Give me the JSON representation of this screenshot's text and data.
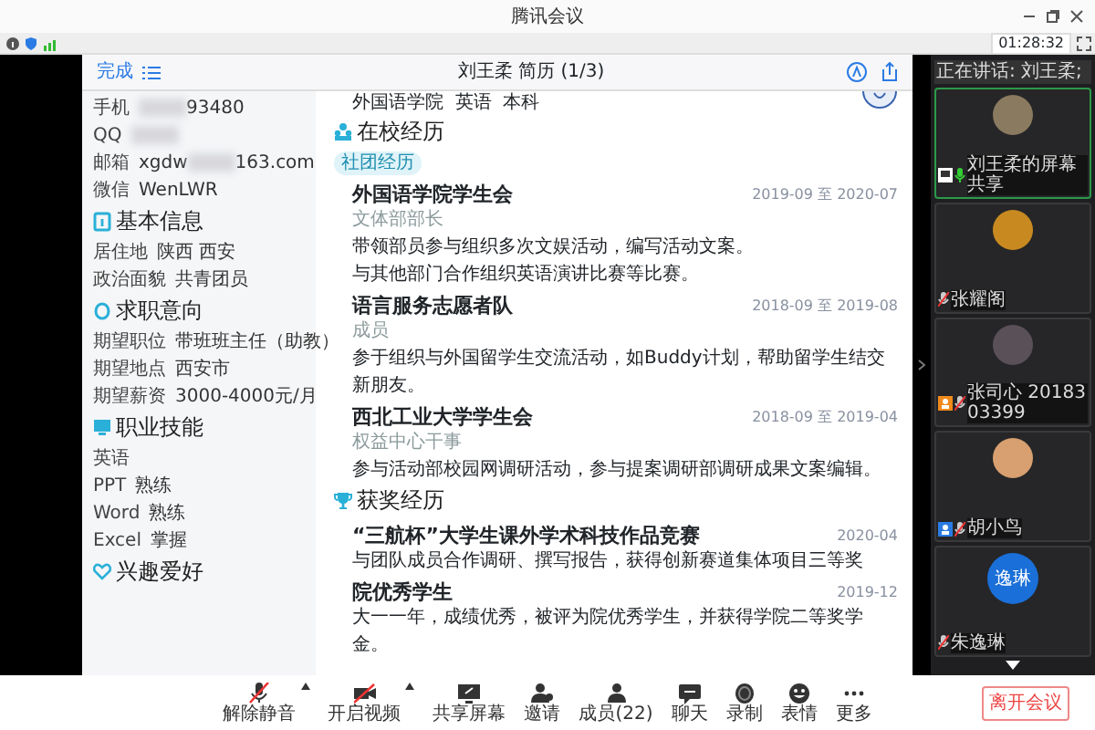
{
  "window": {
    "title": "腾讯会议"
  },
  "status_bar": {
    "timer": "01:28:32"
  },
  "document": {
    "done": "完成",
    "title": "刘王柔 简历 (1/3)",
    "education_line": "外国语学院  英语  本科",
    "contacts": [
      {
        "label": "手机",
        "parts": [
          {
            "kind": "blur"
          },
          {
            "kind": "text",
            "text": "93480"
          }
        ]
      },
      {
        "label": "QQ",
        "parts": [
          {
            "kind": "blur"
          }
        ]
      },
      {
        "label": "邮箱",
        "parts": [
          {
            "kind": "text",
            "text": "xgdw"
          },
          {
            "kind": "blur"
          },
          {
            "kind": "text",
            "text": "163.com"
          }
        ]
      },
      {
        "label": "微信",
        "parts": [
          {
            "kind": "text",
            "text": "WenLWR"
          }
        ]
      }
    ],
    "left_sections": [
      {
        "title": "基本信息",
        "items": [
          {
            "label": "居住地",
            "value": "陕西 西安"
          },
          {
            "label": "政治面貌",
            "value": "共青团员"
          }
        ]
      },
      {
        "title": "求职意向",
        "items": [
          {
            "label": "期望职位",
            "value": "带班班主任（助教）"
          },
          {
            "label": "期望地点",
            "value": "西安市"
          },
          {
            "label": "期望薪资",
            "value": "3000-4000元/月"
          }
        ]
      },
      {
        "title": "职业技能",
        "items": [
          {
            "label": "英语"
          },
          {
            "label": "PPT",
            "value": "熟练"
          },
          {
            "label": "Word",
            "value": "熟练"
          },
          {
            "label": "Excel",
            "value": "掌握"
          }
        ]
      },
      {
        "title": "兴趣爱好"
      }
    ],
    "right_sections": [
      {
        "title": "在校经历",
        "tag": "社团经历",
        "entries": [
          {
            "title": "外国语学院学生会",
            "date": "2019-09 至 2020-07",
            "role": "文体部部长",
            "lines": [
              "带领部员参与组织多次文娱活动，编写活动文案。",
              "与其他部门合作组织英语演讲比赛等比赛。"
            ]
          },
          {
            "title": "语言服务志愿者队",
            "date": "2018-09 至 2019-08",
            "role": "成员",
            "lines": [
              "参于组织与外国留学生交流活动，如Buddy计划，帮助留学生结交新朋友。"
            ]
          },
          {
            "title": "西北工业大学学生会",
            "date": "2018-09 至 2019-04",
            "role": "权益中心干事",
            "lines": [
              "参与活动部校园网调研活动，参与提案调研部调研成果文案编辑。"
            ]
          }
        ]
      },
      {
        "title": "获奖经历",
        "entries": [
          {
            "title": "“三航杯”大学生课外学术科技作品竞赛",
            "date": "2020-04",
            "lines": [
              "与团队成员合作调研、撰写报告，获得创新赛道集体项目三等奖"
            ]
          },
          {
            "title": "院优秀学生",
            "date": "2019-12",
            "lines": [
              "大一一年，成绩优秀，被评为院优秀学生，并获得学院二等奖学金。"
            ]
          }
        ]
      }
    ]
  },
  "panel": {
    "speaking": "正在讲话: 刘王柔;",
    "participants": [
      {
        "name": "刘王柔的屏幕共享",
        "kind": "screen-share",
        "muted": false,
        "color": "#8a7a60",
        "selected": true
      },
      {
        "name": "张耀阁",
        "kind": "member",
        "muted": true,
        "color": "#c88a20",
        "selected": false
      },
      {
        "name": "张司心 2018303399",
        "kind": "host",
        "muted": true,
        "color": "#5a5058",
        "selected": false
      },
      {
        "name": "胡小鸟",
        "kind": "cohost",
        "muted": true,
        "color": "#d8a070",
        "selected": false
      },
      {
        "name": "朱逸琳",
        "kind": "member",
        "muted": true,
        "initials": "逸琳",
        "color": "#1a6fd8",
        "selected": false
      }
    ]
  },
  "toolbar": [
    {
      "kind": "mic-off",
      "label": "解除静音",
      "caret": true
    },
    {
      "kind": "video-off",
      "label": "开启视频",
      "caret": true
    },
    {
      "kind": "share",
      "label": "共享屏幕",
      "caret": false
    },
    {
      "kind": "invite",
      "label": "邀请",
      "caret": false
    },
    {
      "kind": "members",
      "label": "成员(22)",
      "caret": false
    },
    {
      "kind": "chat",
      "label": "聊天",
      "caret": false
    },
    {
      "kind": "record",
      "label": "录制",
      "caret": false
    },
    {
      "kind": "emoji",
      "label": "表情",
      "caret": false
    },
    {
      "kind": "more",
      "label": "更多",
      "caret": false
    }
  ],
  "leave_button": "离开会议"
}
